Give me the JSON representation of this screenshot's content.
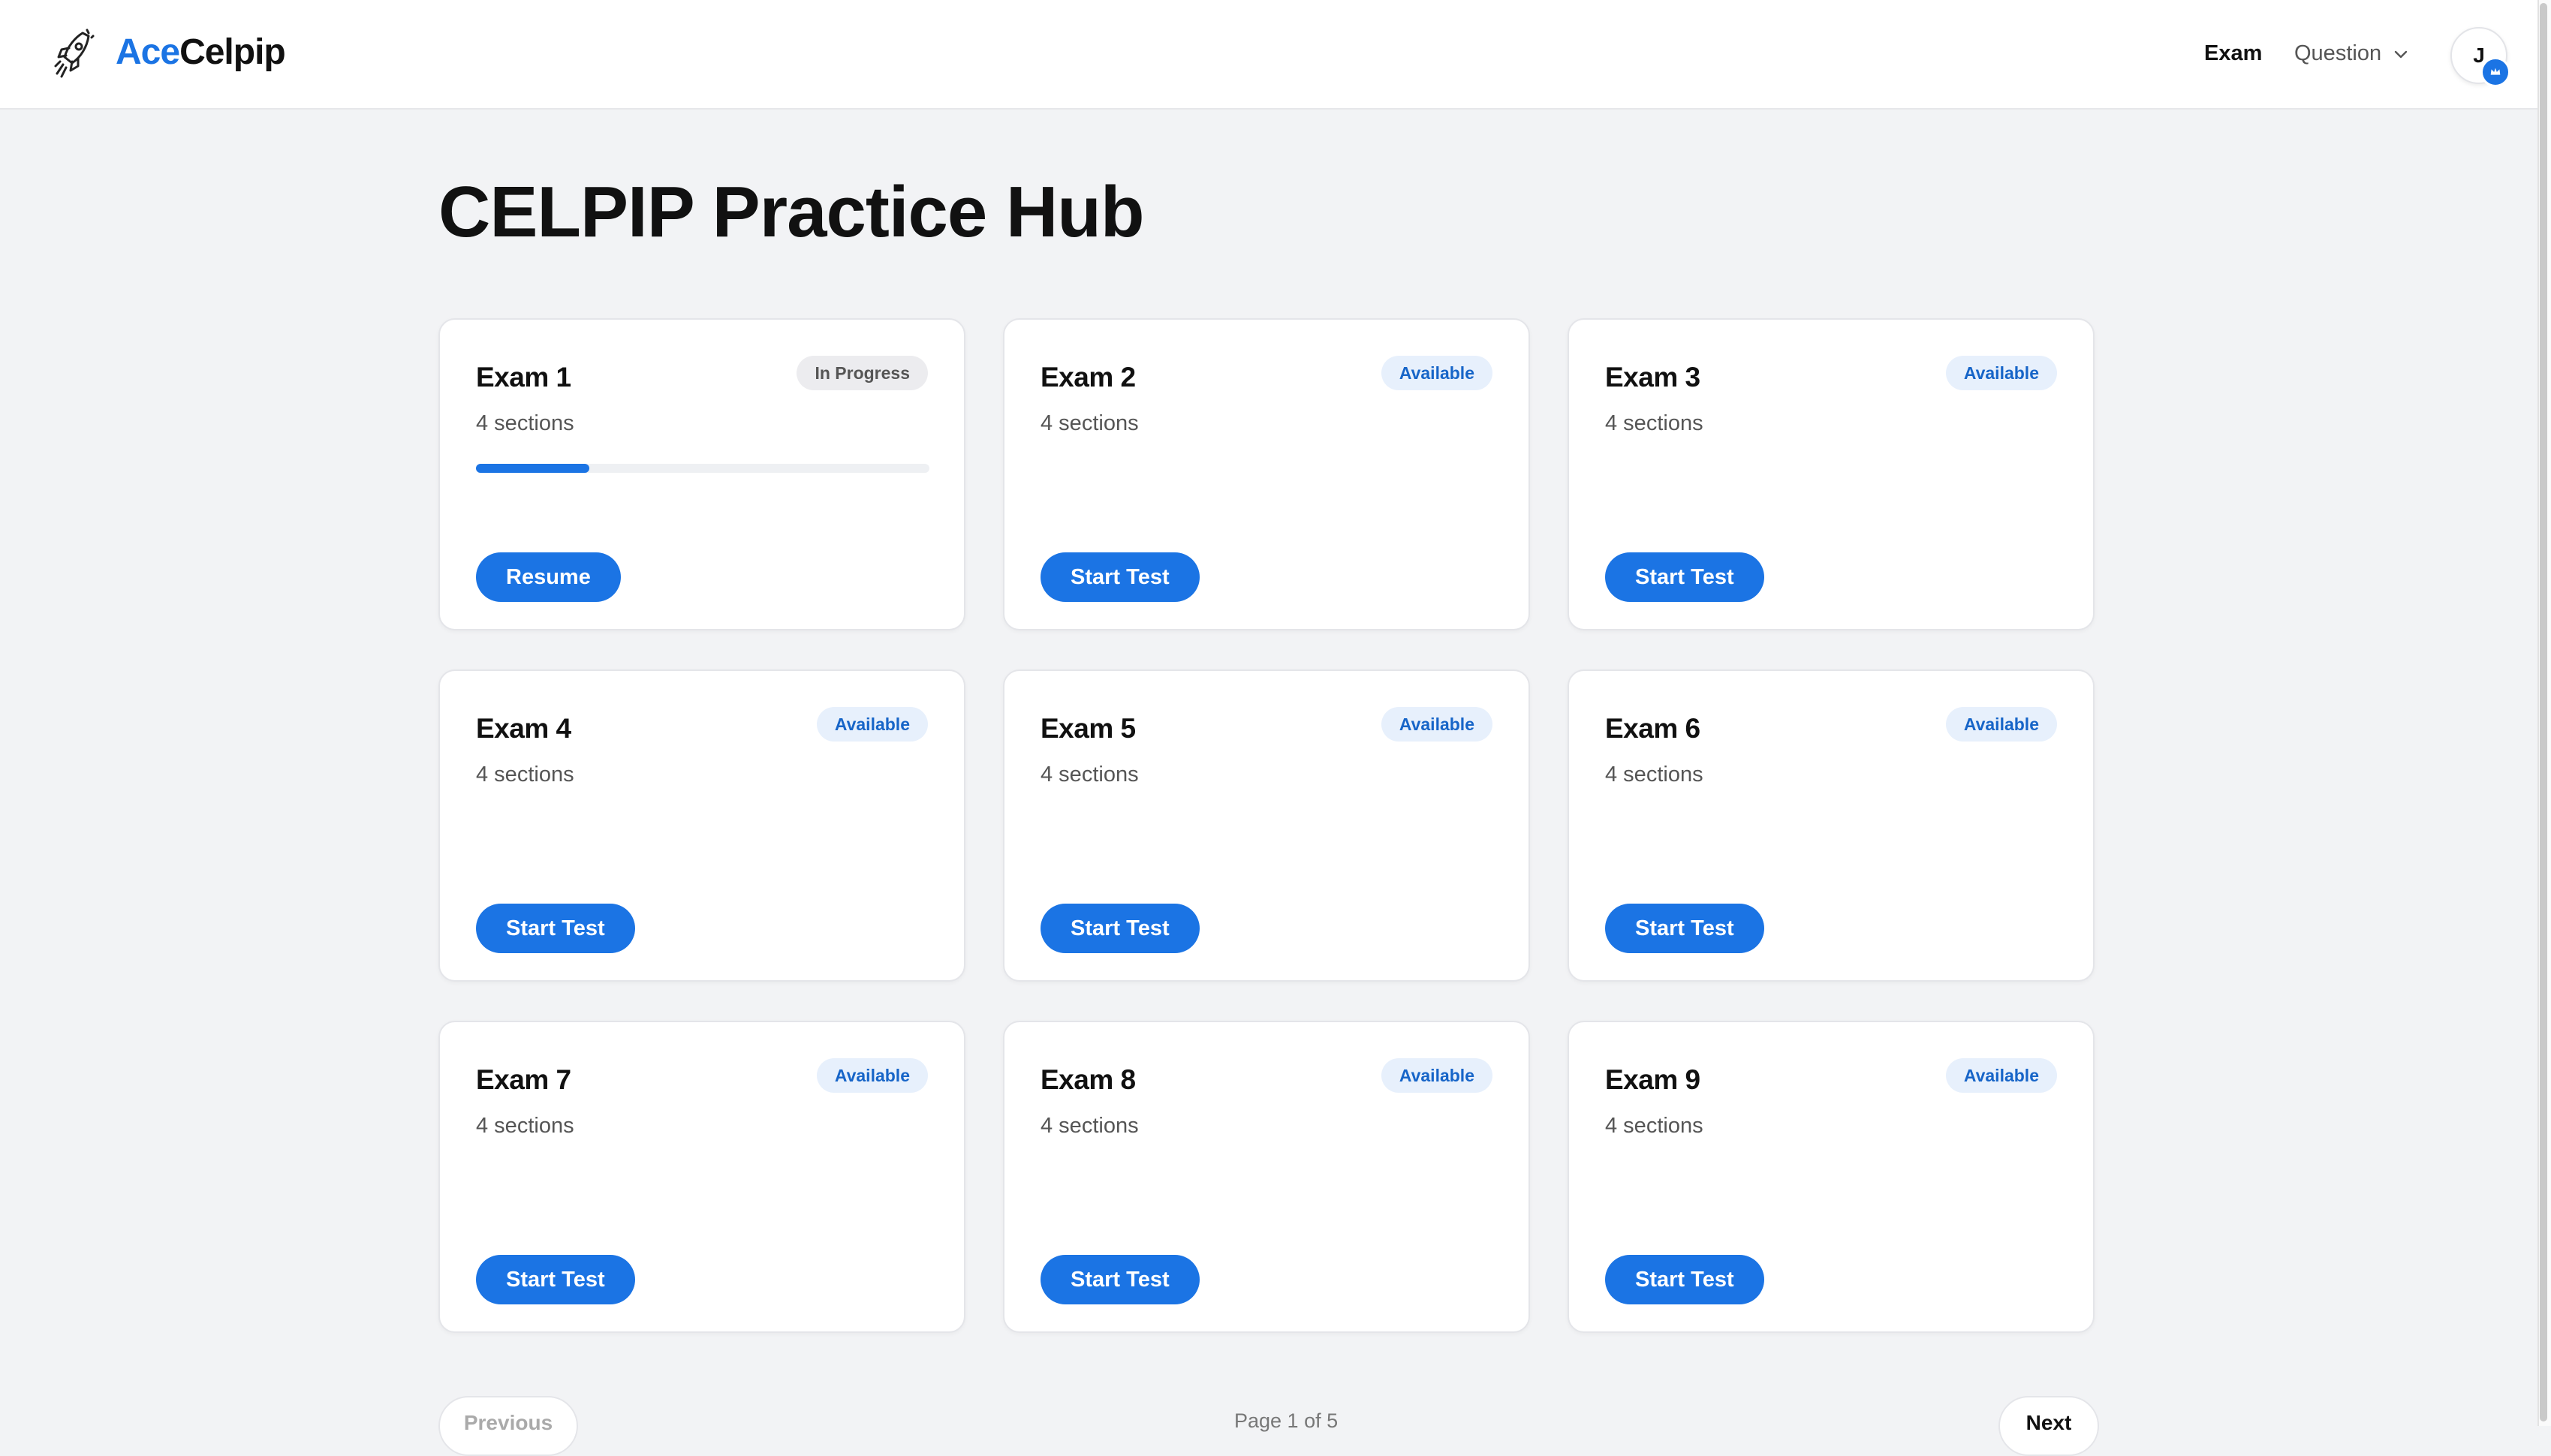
{
  "app": {
    "brand_part1": "Ace",
    "brand_part2": "Celpip",
    "logo_icon": "rocket-icon"
  },
  "nav": {
    "exam_label": "Exam",
    "question_label": "Question",
    "avatar_initial": "J"
  },
  "page": {
    "title": "CELPIP Practice Hub"
  },
  "exams": [
    {
      "title": "Exam 1",
      "sections": "4 sections",
      "status": "In Progress",
      "progress": 0.25,
      "action": "Resume"
    },
    {
      "title": "Exam 2",
      "sections": "4 sections",
      "status": "Available",
      "action": "Start Test"
    },
    {
      "title": "Exam 3",
      "sections": "4 sections",
      "status": "Available",
      "action": "Start Test"
    },
    {
      "title": "Exam 4",
      "sections": "4 sections",
      "status": "Available",
      "action": "Start Test"
    },
    {
      "title": "Exam 5",
      "sections": "4 sections",
      "status": "Available",
      "action": "Start Test"
    },
    {
      "title": "Exam 6",
      "sections": "4 sections",
      "status": "Available",
      "action": "Start Test"
    },
    {
      "title": "Exam 7",
      "sections": "4 sections",
      "status": "Available",
      "action": "Start Test"
    },
    {
      "title": "Exam 8",
      "sections": "4 sections",
      "status": "Available",
      "action": "Start Test"
    },
    {
      "title": "Exam 9",
      "sections": "4 sections",
      "status": "Available",
      "action": "Start Test"
    }
  ],
  "pagination": {
    "previous_label": "Previous",
    "info": "Page 1 of 5",
    "next_label": "Next"
  },
  "colors": {
    "accent": "#1b74e4",
    "background": "#f2f3f5",
    "available_badge_bg": "#e7f0fc",
    "progress_badge_bg": "#ececef"
  }
}
